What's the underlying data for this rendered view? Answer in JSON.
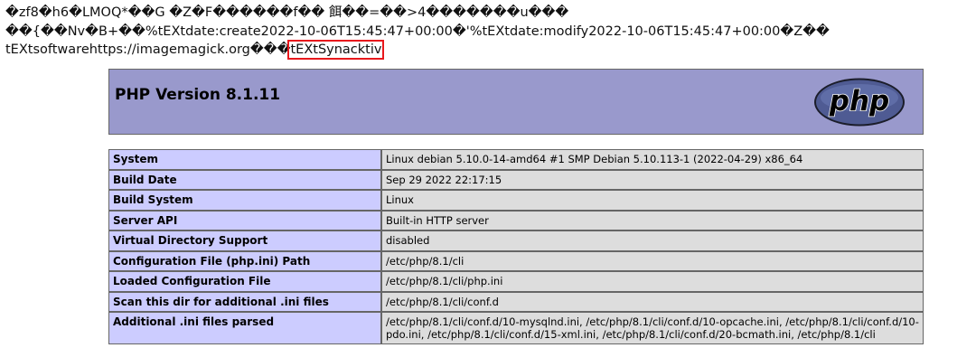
{
  "garbage_text": {
    "line1": "�zf8�h6�LMOQ*��G �Z�F������f�� 餌��=��>4�������u���",
    "line2": "��{��Nv�B+��%tEXtdate:create2022-10-06T15:45:47+00:00�'%tEXtdate:modify2022-10-06T15:45:47+00:00�Z��",
    "line3_prefix": "tEXtsoftwarehttps://imagemagick.org���",
    "line3_highlight": "tEXtSynacktiv"
  },
  "header": {
    "title": "PHP Version 8.1.11",
    "logo_text": "php",
    "logo_color": "#4f5b93"
  },
  "info_rows": [
    {
      "label": "System",
      "value": "Linux debian 5.10.0-14-amd64 #1 SMP Debian 5.10.113-1 (2022-04-29) x86_64"
    },
    {
      "label": "Build Date",
      "value": "Sep 29 2022 22:17:15"
    },
    {
      "label": "Build System",
      "value": "Linux"
    },
    {
      "label": "Server API",
      "value": "Built-in HTTP server"
    },
    {
      "label": "Virtual Directory Support",
      "value": "disabled"
    },
    {
      "label": "Configuration File (php.ini) Path",
      "value": "/etc/php/8.1/cli"
    },
    {
      "label": "Loaded Configuration File",
      "value": "/etc/php/8.1/cli/php.ini"
    },
    {
      "label": "Scan this dir for additional .ini files",
      "value": "/etc/php/8.1/cli/conf.d"
    },
    {
      "label": "Additional .ini files parsed",
      "value": "/etc/php/8.1/cli/conf.d/10-mysqlnd.ini, /etc/php/8.1/cli/conf.d/10-opcache.ini, /etc/php/8.1/cli/conf.d/10-pdo.ini, /etc/php/8.1/cli/conf.d/15-xml.ini, /etc/php/8.1/cli/conf.d/20-bcmath.ini, /etc/php/8.1/cli"
    }
  ],
  "colors": {
    "header_bg": "#9999cc",
    "label_bg": "#ccccff",
    "value_bg": "#dddddd",
    "highlight_border": "#e8181c"
  }
}
